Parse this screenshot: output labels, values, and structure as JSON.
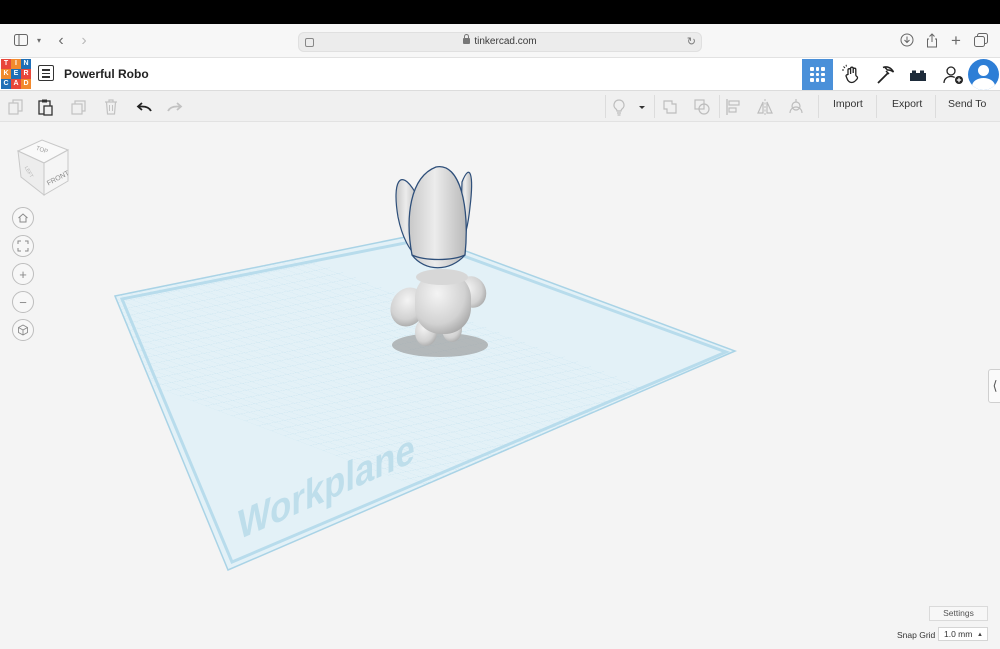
{
  "browser": {
    "url": "tinkercad.com"
  },
  "app": {
    "logo_letters": [
      "T",
      "I",
      "N",
      "K",
      "E",
      "R",
      "C",
      "A",
      "D"
    ],
    "logo_colors": [
      "#e8473a",
      "#f28a2d",
      "#1f6fb6",
      "#f28a2d",
      "#1f6fb6",
      "#e8473a",
      "#1f6fb6",
      "#e8473a",
      "#f28a2d"
    ],
    "project_title": "Powerful Robo",
    "accent_color": "#4a90d9"
  },
  "toolbar": {
    "import_label": "Import",
    "export_label": "Export",
    "send_to_label": "Send To"
  },
  "view_cube": {
    "top_label": "TOP",
    "front_label": "FRONT",
    "left_label": "LEFT"
  },
  "workplane": {
    "label": "Workplane"
  },
  "footer": {
    "settings_label": "Settings",
    "snap_grid_label": "Snap Grid",
    "snap_grid_value": "1.0 mm"
  }
}
